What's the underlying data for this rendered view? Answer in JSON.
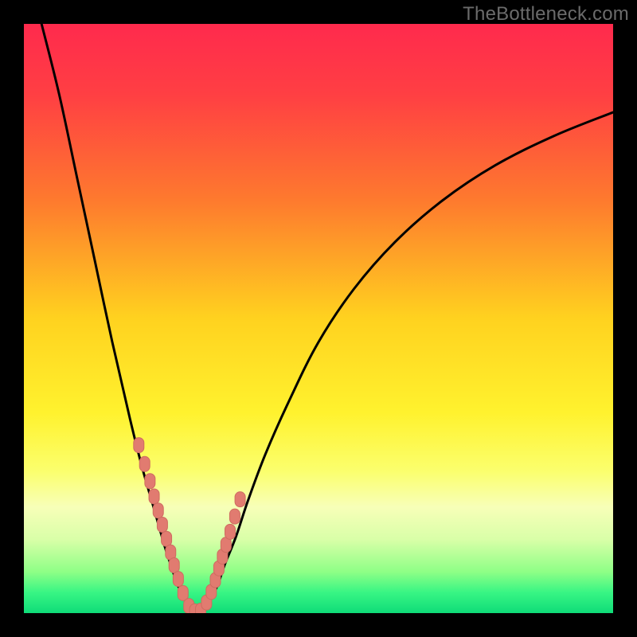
{
  "watermark": "TheBottleneck.com",
  "colors": {
    "frame": "#000000",
    "curve": "#000000",
    "marker_fill": "#e17b70",
    "marker_stroke": "#cf6b60",
    "gradient_stops": [
      {
        "offset": 0.0,
        "color": "#ff2a4d"
      },
      {
        "offset": 0.12,
        "color": "#ff3f43"
      },
      {
        "offset": 0.3,
        "color": "#fe7a2e"
      },
      {
        "offset": 0.5,
        "color": "#ffd21f"
      },
      {
        "offset": 0.66,
        "color": "#fff22e"
      },
      {
        "offset": 0.76,
        "color": "#fbff6e"
      },
      {
        "offset": 0.82,
        "color": "#f7ffb8"
      },
      {
        "offset": 0.875,
        "color": "#d9ffa8"
      },
      {
        "offset": 0.93,
        "color": "#8eff86"
      },
      {
        "offset": 0.965,
        "color": "#38f584"
      },
      {
        "offset": 1.0,
        "color": "#0fdc78"
      }
    ]
  },
  "chart_data": {
    "type": "line",
    "title": "",
    "xlabel": "",
    "ylabel": "",
    "xlim": [
      0,
      100
    ],
    "ylim": [
      0,
      100
    ],
    "note": "V-shaped bottleneck curve. y≈0 near optimum around x≈27–31; rises steeply on both sides. Coordinates approximate (percent of plot area, origin bottom-left).",
    "series": [
      {
        "name": "curve-left",
        "x": [
          3,
          6,
          9,
          12,
          15,
          18,
          20,
          22,
          24,
          25,
          26,
          27,
          28,
          29
        ],
        "y": [
          100,
          88,
          74,
          60,
          46,
          33,
          25,
          18,
          11,
          8,
          5,
          3,
          1,
          0
        ]
      },
      {
        "name": "curve-right",
        "x": [
          30,
          31,
          32,
          33,
          34,
          36,
          38,
          41,
          45,
          50,
          56,
          63,
          71,
          80,
          90,
          100
        ],
        "y": [
          0,
          1,
          3,
          5,
          8,
          13,
          19,
          27,
          36,
          46,
          55,
          63,
          70,
          76,
          81,
          85
        ]
      }
    ],
    "markers": {
      "name": "sample-points",
      "note": "Clusters of pink lozenge markers along both arms near the valley.",
      "x": [
        19.5,
        20.5,
        21.4,
        22.1,
        22.8,
        23.5,
        24.2,
        24.9,
        25.5,
        26.2,
        27.0,
        28.0,
        29.0,
        30.0,
        31.0,
        31.8,
        32.5,
        33.1,
        33.7,
        34.3,
        35.0,
        35.8,
        36.7
      ],
      "y": [
        28.5,
        25.3,
        22.4,
        19.8,
        17.4,
        15.0,
        12.6,
        10.3,
        8.1,
        5.8,
        3.4,
        1.2,
        0.3,
        0.4,
        1.8,
        3.6,
        5.6,
        7.6,
        9.6,
        11.6,
        13.8,
        16.4,
        19.3
      ]
    }
  }
}
